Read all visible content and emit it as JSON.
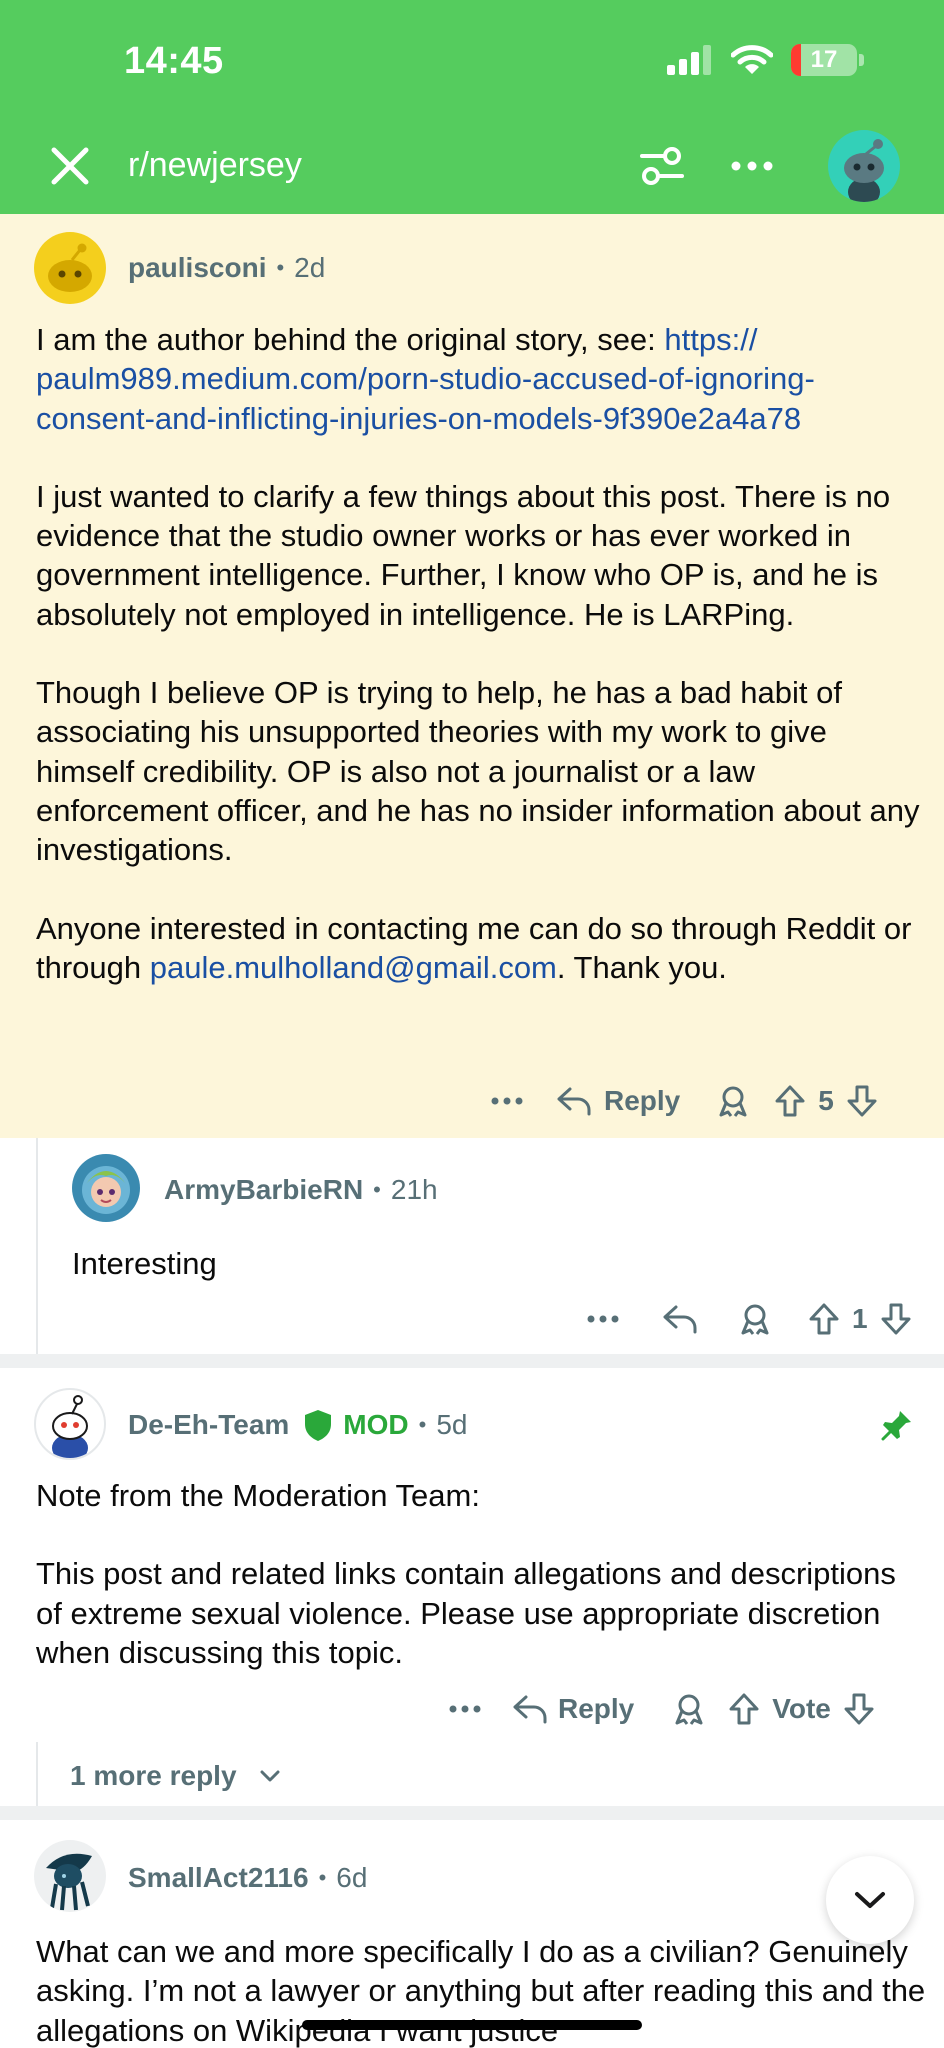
{
  "status_bar": {
    "time": "14:45",
    "battery": "17"
  },
  "header": {
    "subreddit": "r/newjersey"
  },
  "comments": [
    {
      "user": "paulisconi",
      "age": "2d",
      "paragraphs": [
        {
          "text": "I am the author behind the original story, see: ",
          "link": "https://paulm989.medium.com/porn-studio-accused-of-ignoring-consent-and-inflicting-injuries-on-models-9f390e2a4a78",
          "link_display_1": "https://",
          "link_display_2": "paulm989.medium.com/porn-studio-accused-of-ignoring-",
          "link_display_3": "consent-and-inflicting-injuries-on-models-9f390e2a4a78"
        },
        {
          "text": "I just wanted to clarify a few things about this post. There is no evidence that the studio owner works or has ever worked in government intelligence. Further, I know who OP is, and he is absolutely not employed in intelligence. He is LARPing."
        },
        {
          "text": "Though I believe OP is trying to help, he has a bad habit of associating his unsupported theories with my work to give himself credibility. OP is also not a journalist or a law enforcement officer, and he has no insider information about any investigations."
        },
        {
          "text_before": "Anyone interested in contacting me can do so through Reddit or through ",
          "email": "paule.mulholland@gmail.com",
          "text_after": ". Thank you."
        }
      ],
      "reply_label": "Reply",
      "score": "5"
    },
    {
      "user": "ArmyBarbieRN",
      "age": "21h",
      "text": "Interesting",
      "score": "1"
    },
    {
      "user": "De-Eh-Team",
      "mod_label": "MOD",
      "age": "5d",
      "paragraph_1": "Note from the Moderation Team:",
      "paragraph_2": "This post and related links contain allegations and descriptions of extreme sexual violence. Please use appropriate discretion when discussing this topic.",
      "reply_label": "Reply",
      "vote_label": "Vote",
      "more_replies": "1 more reply"
    },
    {
      "user": "SmallAct2116",
      "age": "6d",
      "text": "What can we and more specifically I do as a civilian? Genuinely asking. I’m not a lawyer or anything but after reading this and the allegations on Wikipedia I want justice"
    }
  ],
  "colors": {
    "header_green": "#55cc5e",
    "highlight_bg": "#fdf6da",
    "link_blue": "#1a4fa3",
    "mod_green": "#2aa83a",
    "meta_gray": "#576f76"
  }
}
